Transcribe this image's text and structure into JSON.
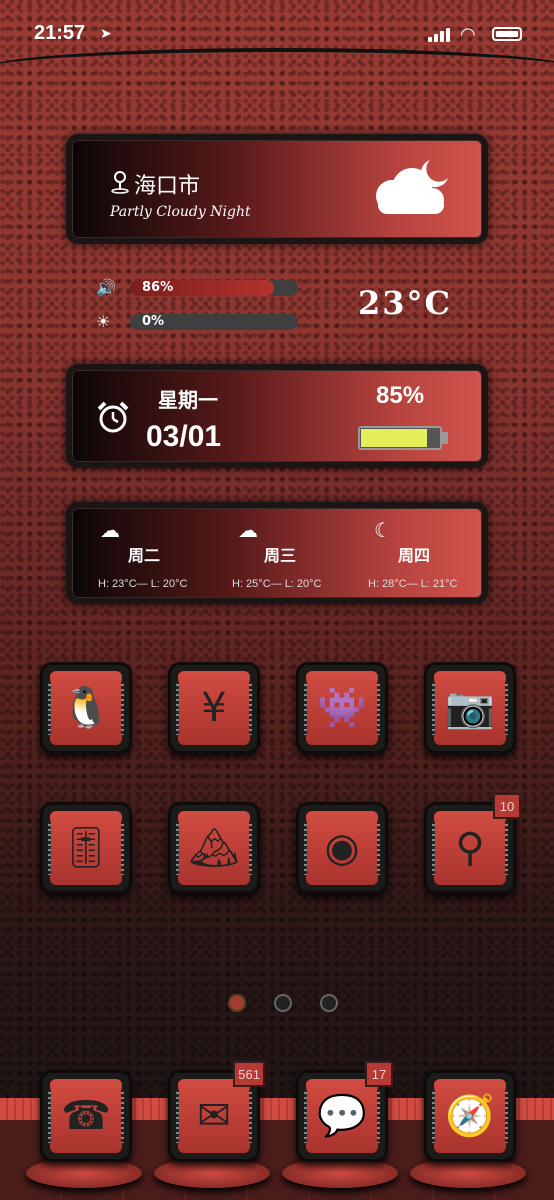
{
  "status_bar": {
    "time": "21:57"
  },
  "weather": {
    "city": "海口市",
    "condition": "Partly Cloudy Night",
    "temperature": "23°C"
  },
  "sliders": {
    "volume": {
      "label": "86%",
      "value": 0.86
    },
    "brightness": {
      "label": "0%",
      "value": 0.0
    }
  },
  "date_widget": {
    "weekday": "星期一",
    "date": "03/01",
    "battery_label": "85%",
    "battery_value": 0.85,
    "battery_color": "#e6ee5c"
  },
  "forecast": [
    {
      "day": "周二",
      "icon": "cloud-icon",
      "hl": "H: 23°C— L: 20°C"
    },
    {
      "day": "周三",
      "icon": "cloud-moon-icon",
      "hl": "H: 25°C— L: 20°C"
    },
    {
      "day": "周四",
      "icon": "moon-icon",
      "hl": "H: 28°C— L: 21°C"
    }
  ],
  "apps_row1": [
    {
      "name": "qq-app",
      "glyph": "🐧"
    },
    {
      "name": "alipay-app",
      "glyph": "¥"
    },
    {
      "name": "game-app",
      "glyph": "👾"
    },
    {
      "name": "camera-cartoon-app",
      "glyph": "📷"
    }
  ],
  "apps_row2": [
    {
      "name": "settings-app",
      "glyph": "🎚"
    },
    {
      "name": "photos-app",
      "glyph": "🏔"
    },
    {
      "name": "camera-app",
      "glyph": "◉"
    },
    {
      "name": "necklace-app",
      "glyph": "⚲",
      "badge": "10"
    }
  ],
  "dock": [
    {
      "name": "phone-app",
      "glyph": "☎",
      "label": "phone"
    },
    {
      "name": "mail-app",
      "glyph": "✉",
      "badge": "561"
    },
    {
      "name": "wechat-app",
      "glyph": "💬",
      "badge": "17"
    },
    {
      "name": "compass-app",
      "glyph": "🧭"
    }
  ],
  "page_dots": {
    "count": 3,
    "active": 0
  },
  "colors": {
    "accent": "#b53a33",
    "card_dark": "#0c0606",
    "card_light": "#d0534c"
  }
}
